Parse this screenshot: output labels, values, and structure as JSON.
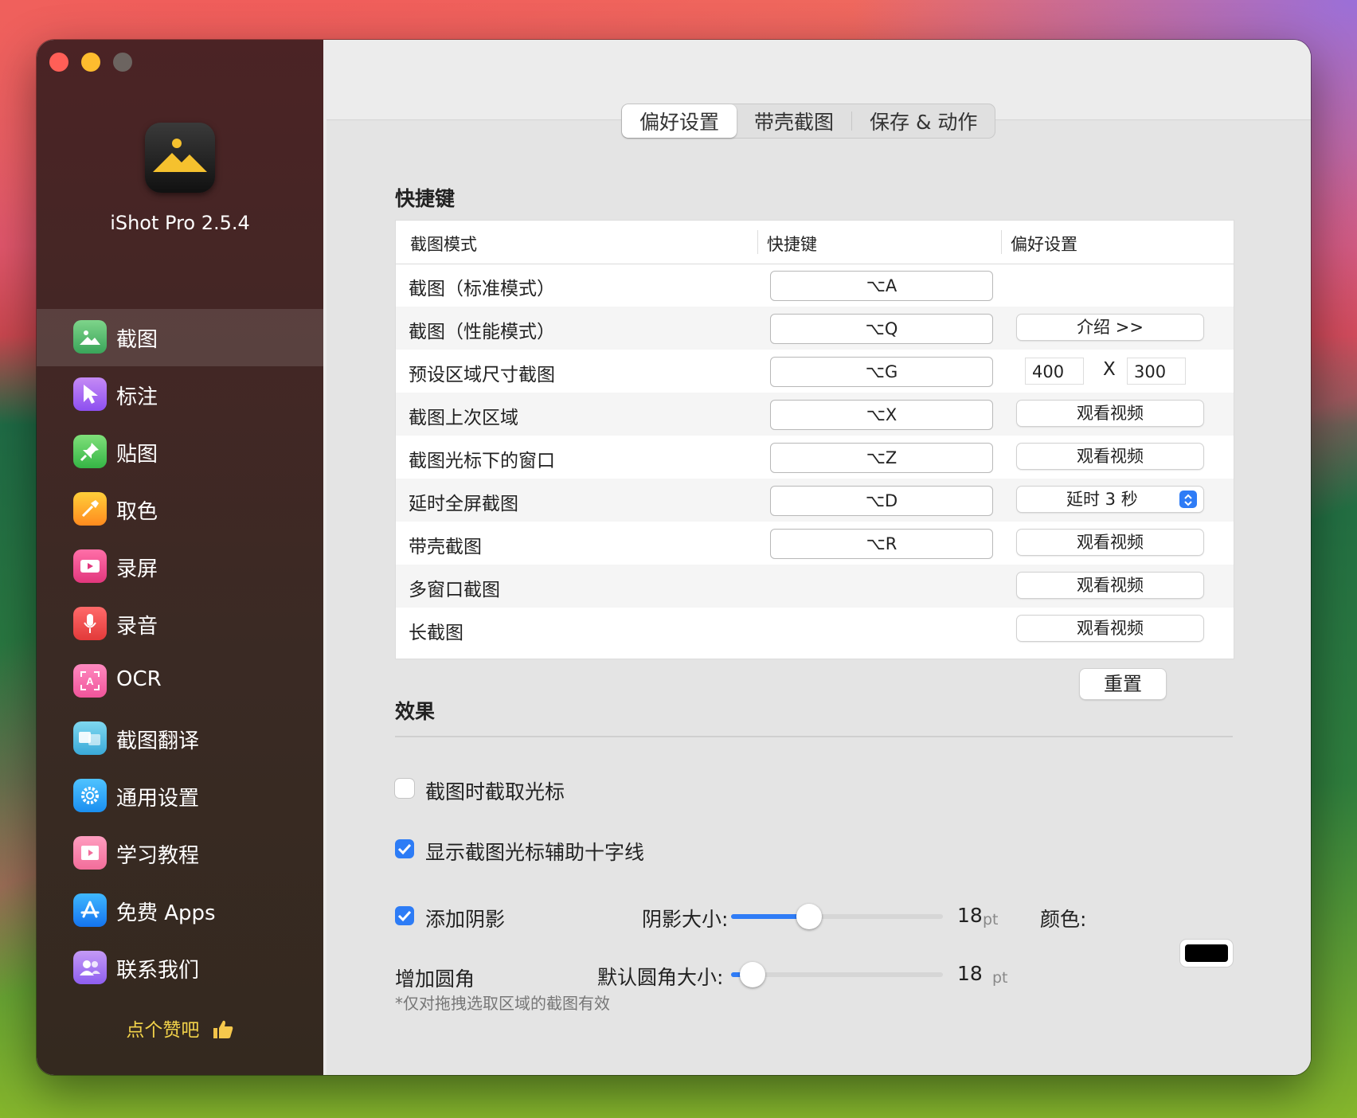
{
  "app": {
    "name": "iShot Pro 2.5.4"
  },
  "sidebar": {
    "items": [
      {
        "label": "截图",
        "icon": "screenshot-icon"
      },
      {
        "label": "标注",
        "icon": "annotate-icon"
      },
      {
        "label": "贴图",
        "icon": "pin-icon"
      },
      {
        "label": "取色",
        "icon": "color-picker-icon"
      },
      {
        "label": "录屏",
        "icon": "screen-record-icon"
      },
      {
        "label": "录音",
        "icon": "microphone-icon"
      },
      {
        "label": "OCR",
        "icon": "ocr-icon"
      },
      {
        "label": "截图翻译",
        "icon": "translate-icon"
      },
      {
        "label": "通用设置",
        "icon": "gear-icon"
      },
      {
        "label": "学习教程",
        "icon": "tutorial-icon"
      },
      {
        "label": "免费 Apps",
        "icon": "app-store-icon"
      },
      {
        "label": "联系我们",
        "icon": "contact-icon"
      }
    ],
    "active_index": 0,
    "likes": "点个赞吧"
  },
  "tabs": [
    "偏好设置",
    "带壳截图",
    "保存 & 动作"
  ],
  "active_tab": 0,
  "shortcuts": {
    "title": "快捷键",
    "headers": [
      "截图模式",
      "快捷键",
      "偏好设置"
    ],
    "rows": [
      {
        "mode": "截图（标准模式）",
        "key": "⌥A"
      },
      {
        "mode": "截图（性能模式）",
        "key": "⌥Q",
        "action": "介绍  >>"
      },
      {
        "mode": "预设区域尺寸截图",
        "key": "⌥G",
        "width": "400",
        "x": "X",
        "height": "300"
      },
      {
        "mode": "截图上次区域",
        "key": "⌥X",
        "action": "观看视频"
      },
      {
        "mode": "截图光标下的窗口",
        "key": "⌥Z",
        "action": "观看视频"
      },
      {
        "mode": "延时全屏截图",
        "key": "⌥D",
        "select": "延时 3 秒"
      },
      {
        "mode": "带壳截图",
        "key": "⌥R",
        "action": "观看视频"
      },
      {
        "mode": "多窗口截图",
        "action": "观看视频"
      },
      {
        "mode": "长截图",
        "action": "观看视频"
      }
    ],
    "reset": "重置"
  },
  "effects": {
    "title": "效果",
    "capture_cursor": {
      "label": "截图时截取光标",
      "checked": false
    },
    "crosshair": {
      "label": "显示截图光标辅助十字线",
      "checked": true
    },
    "shadow": {
      "label": "添加阴影",
      "checked": true,
      "size_label": "阴影大小:",
      "value": "18",
      "unit": "pt",
      "color_label": "颜色:",
      "color": "#000000",
      "slider_fraction": 0.37
    },
    "corner": {
      "label": "增加圆角",
      "size_label": "默认圆角大小:",
      "value": "18",
      "unit": "pt",
      "slider_fraction": 0.1
    },
    "note": "*仅对拖拽选取区域的截图有效"
  },
  "accent": "#2f7cf6"
}
